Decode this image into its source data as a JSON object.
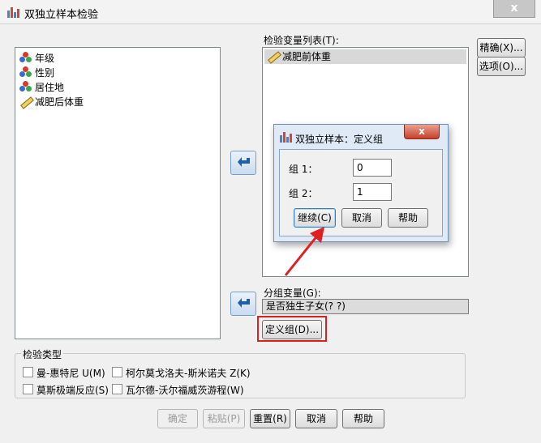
{
  "window": {
    "title": "双独立样本检验",
    "close_glyph": "x"
  },
  "source_vars": [
    {
      "label": "年级",
      "icon": "nominal-icon"
    },
    {
      "label": "性别",
      "icon": "nominal-icon"
    },
    {
      "label": "居住地",
      "icon": "nominal-icon"
    },
    {
      "label": "减肥后体重",
      "icon": "scale-icon"
    }
  ],
  "test_vars": {
    "label": "检验变量列表(T):",
    "items": [
      {
        "label": "减肥前体重",
        "icon": "scale-icon"
      }
    ]
  },
  "grouping": {
    "label": "分组变量(G):",
    "value": "是否独生子女(? ?)",
    "define_button": "定义组(D)..."
  },
  "side_buttons": {
    "exact": "精确(X)...",
    "options": "选项(O)..."
  },
  "test_type": {
    "label": "检验类型",
    "options": [
      {
        "label": "曼-惠特尼 U(M)",
        "checked": false
      },
      {
        "label": "柯尔莫戈洛夫-斯米诺夫 Z(K)",
        "checked": false
      },
      {
        "label": "莫斯极端反应(S)",
        "checked": false
      },
      {
        "label": "瓦尔德-沃尔福威茨游程(W)",
        "checked": false
      }
    ]
  },
  "bottom_buttons": {
    "ok": "确定",
    "paste": "粘贴(P)",
    "reset": "重置(R)",
    "cancel": "取消",
    "help": "帮助"
  },
  "define_groups": {
    "title": "双独立样本：定义组",
    "close_glyph": "x",
    "group1_label": "组 1：",
    "group1_value": "0",
    "group2_label": "组 2：",
    "group2_value": "1",
    "continue": "继续(C)",
    "cancel": "取消",
    "help": "帮助"
  },
  "colors": {
    "accent_red": "#e02020",
    "dialog_bg": "#f0f0f0",
    "selection_bg": "#d8d8d8"
  }
}
